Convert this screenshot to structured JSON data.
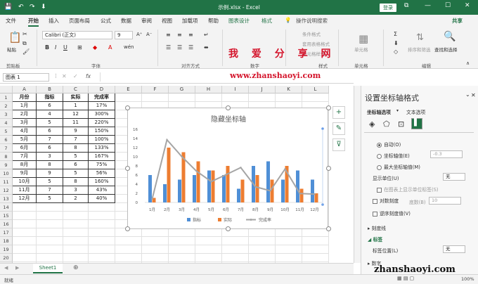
{
  "titlebar": {
    "title": "示例.xlsx  -  Excel",
    "login": "登录",
    "quick_access": [
      "💾",
      "↶",
      "↷",
      "⬇"
    ],
    "window_buttons": [
      "⧉",
      "—",
      "☐",
      "✕"
    ]
  },
  "tabs": [
    "文件",
    "开始",
    "插入",
    "页面布局",
    "公式",
    "数据",
    "审阅",
    "视图",
    "加载项",
    "帮助",
    "图表设计",
    "格式",
    "操作说明搜索"
  ],
  "share": "共享",
  "ribbon": {
    "paste": "粘贴",
    "font_name": "Calibri (正文)",
    "font_size": "9",
    "groups": [
      "剪贴板",
      "字体",
      "对齐方式",
      "数字",
      "样式",
      "单元格",
      "编辑"
    ],
    "styles_items": [
      "条件格式",
      "套用表格格式",
      "单元格样式"
    ],
    "cells_label": "单元格",
    "edit_items": [
      "排序和筛选",
      "查找和选择"
    ]
  },
  "watermark": {
    "text": "我 爱 分 享 网",
    "url": "www.zhanshaoyi.com",
    "bottom": "zhanshaoyi.com"
  },
  "formula_bar": {
    "name_box": "图表 1",
    "fx": "fx"
  },
  "sheet": {
    "columns": [
      "A",
      "B",
      "C",
      "D",
      "E",
      "F",
      "G",
      "H",
      "I",
      "J",
      "K",
      "L"
    ],
    "rows": [
      "1",
      "2",
      "3",
      "4",
      "5",
      "6",
      "7",
      "8",
      "9",
      "10",
      "11",
      "12",
      "13",
      "14",
      "15",
      "16",
      "17",
      "18",
      "19",
      "20",
      "21"
    ],
    "table": [
      [
        "月份",
        "指标",
        "实际",
        "完成率"
      ],
      [
        "1月",
        "6",
        "1",
        "17%"
      ],
      [
        "2月",
        "4",
        "12",
        "300%"
      ],
      [
        "3月",
        "5",
        "11",
        "220%"
      ],
      [
        "4月",
        "6",
        "9",
        "150%"
      ],
      [
        "5月",
        "7",
        "7",
        "100%"
      ],
      [
        "6月",
        "6",
        "8",
        "133%"
      ],
      [
        "7月",
        "3",
        "5",
        "167%"
      ],
      [
        "8月",
        "8",
        "6",
        "75%"
      ],
      [
        "9月",
        "9",
        "5",
        "56%"
      ],
      [
        "10月",
        "5",
        "8",
        "160%"
      ],
      [
        "11月",
        "7",
        "3",
        "43%"
      ],
      [
        "12月",
        "5",
        "2",
        "40%"
      ]
    ],
    "tab": "Sheet1",
    "status": "就绪",
    "zoom": "100%"
  },
  "chart_data": {
    "type": "bar",
    "title": "隐藏坐标轴",
    "categories": [
      "1月",
      "2月",
      "3月",
      "4月",
      "5月",
      "6月",
      "7月",
      "8月",
      "9月",
      "10月",
      "11月",
      "12月"
    ],
    "series": [
      {
        "name": "指标",
        "type": "bar",
        "values": [
          6,
          4,
          5,
          6,
          7,
          6,
          3,
          8,
          9,
          5,
          7,
          5
        ],
        "color": "#4f8fd6"
      },
      {
        "name": "实际",
        "type": "bar",
        "values": [
          1,
          12,
          11,
          9,
          7,
          8,
          5,
          6,
          5,
          8,
          3,
          2
        ],
        "color": "#ed7d31"
      },
      {
        "name": "完成率",
        "type": "line",
        "values": [
          17,
          300,
          220,
          150,
          100,
          133,
          167,
          75,
          56,
          160,
          43,
          40
        ],
        "color": "#a5a5a5"
      }
    ],
    "y_ticks": [
      0,
      2,
      4,
      6,
      8,
      10,
      12,
      14,
      16
    ],
    "ylim": [
      0,
      16
    ],
    "secondary_ylim": [
      0,
      350
    ],
    "legend": "bottom",
    "grid": false
  },
  "pane": {
    "title": "设置坐标轴格式",
    "tab1": "坐标轴选项",
    "tab2": "文本选项",
    "auto": "自动(O)",
    "axis_value": "坐标轴值(E)",
    "axis_value_input": "-0.3",
    "max_axis": "最大坐标轴值(M)",
    "display_units": "显示单位(U)",
    "display_units_value": "无",
    "show_units_label": "在图表上显示单位标签(S)",
    "log_scale": "对数刻度",
    "base_label": "底数(B)",
    "base_value": "10",
    "reverse": "逆序刻度值(V)",
    "tick_marks": "刻度线",
    "labels": "标签",
    "label_position": "标签位置(L)",
    "label_position_value": "无",
    "number": "数字"
  }
}
